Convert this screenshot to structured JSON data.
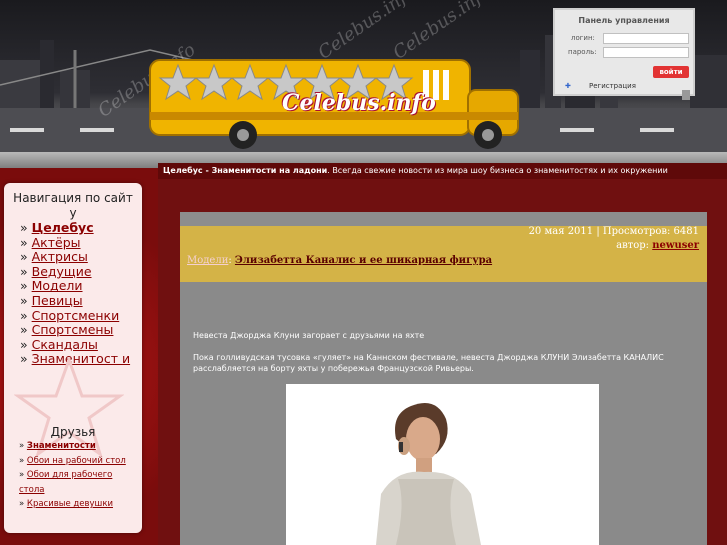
{
  "header": {
    "site_logo": "Celebus.info",
    "watermark": "Celebus.info",
    "control_panel": {
      "title": "Панель управления",
      "login_label": "логин:",
      "password_label": "пароль:",
      "login_button": "войти",
      "register_link": "Регистрация"
    }
  },
  "ticker": {
    "site_name": "Целебус - Знаменитости на ладони",
    "text": ". Всегда свежие новости из мира шоу бизнеса о знаменитостях и их окружении"
  },
  "sidebar": {
    "nav_title": "Навигация по сайт у",
    "nav_items": [
      {
        "label": "Целебус",
        "bold": true
      },
      {
        "label": "Актёры"
      },
      {
        "label": "Актрисы"
      },
      {
        "label": "Ведущие"
      },
      {
        "label": "Модели"
      },
      {
        "label": "Певицы"
      },
      {
        "label": "Спортсменки"
      },
      {
        "label": "Спортсмены"
      },
      {
        "label": "Скандалы"
      },
      {
        "label": "Знаменитост и"
      }
    ],
    "friends_title": "Друзья",
    "friends": [
      {
        "label": "Знаменитости"
      },
      {
        "label": "Обои на рабочий стол"
      },
      {
        "label": "Обои для рабочего стола"
      },
      {
        "label": "Красивые девушки"
      }
    ]
  },
  "article": {
    "date_views": "20 мая 2011 | Просмотров: 6481",
    "author_label": "автор:",
    "author": "newuser",
    "category": "Модели",
    "separator": ":",
    "title": "Элизабетта Каналис и ее шикарная фигура",
    "lead": "Невеста Джорджа Клуни загорает с друзьями на яхте",
    "paragraph": "Пока голливудская тусовка «гуляет» на Каннском фестивале, невеста Джорджа КЛУНИ Элизабетта КАНАЛИС расслабляется на борту яхты у побережья Французской Ривьеры."
  },
  "colors": {
    "background": "#6e0b0b",
    "meta_bar": "#d4b347",
    "content_bg": "#8a8a8a",
    "link": "#8b0000",
    "bus": "#f0b400"
  }
}
